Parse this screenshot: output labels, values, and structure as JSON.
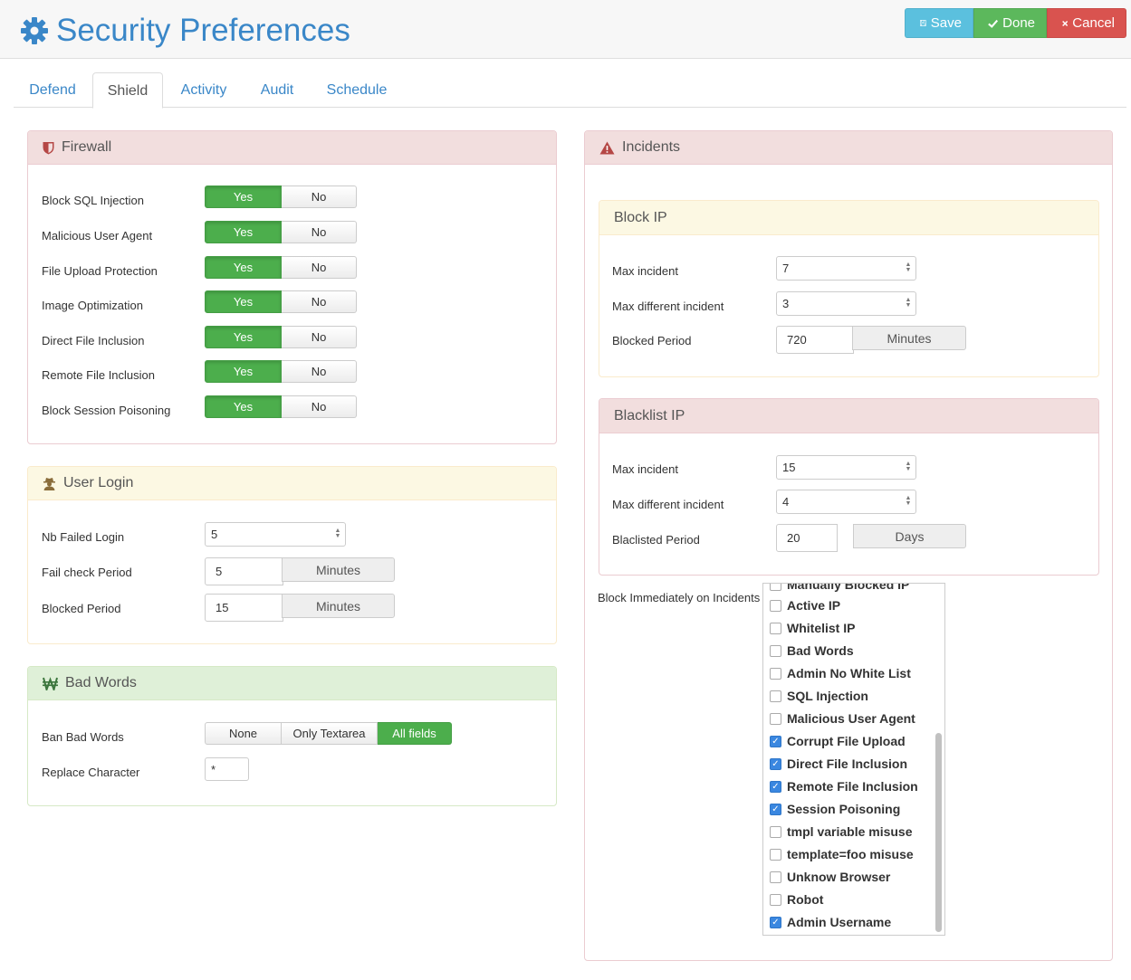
{
  "header": {
    "title": "Security Preferences",
    "buttons": {
      "save": "Save",
      "done": "Done",
      "cancel": "Cancel"
    }
  },
  "tabs": [
    {
      "label": "Defend"
    },
    {
      "label": "Shield",
      "active": true
    },
    {
      "label": "Activity"
    },
    {
      "label": "Audit"
    },
    {
      "label": "Schedule"
    }
  ],
  "firewall": {
    "title": "Firewall",
    "yes": "Yes",
    "no": "No",
    "rows": [
      {
        "label": "Block SQL Injection",
        "value": "Yes"
      },
      {
        "label": "Malicious User Agent",
        "value": "Yes"
      },
      {
        "label": "File Upload Protection",
        "value": "Yes"
      },
      {
        "label": "Image Optimization",
        "value": "Yes"
      },
      {
        "label": "Direct File Inclusion",
        "value": "Yes"
      },
      {
        "label": "Remote File Inclusion",
        "value": "Yes"
      },
      {
        "label": "Block Session Poisoning",
        "value": "Yes"
      }
    ]
  },
  "user_login": {
    "title": "User Login",
    "nb_failed_label": "Nb Failed Login",
    "nb_failed_value": "5",
    "fail_check_label": "Fail check Period",
    "fail_check_value": "5",
    "fail_check_unit": "Minutes",
    "blocked_label": "Blocked Period",
    "blocked_value": "15",
    "blocked_unit": "Minutes"
  },
  "bad_words": {
    "title": "Bad Words",
    "ban_label": "Ban Bad Words",
    "options": [
      "None",
      "Only Textarea",
      "All fields"
    ],
    "selected": "All fields",
    "replace_label": "Replace Character",
    "replace_value": "*"
  },
  "incidents": {
    "title": "Incidents",
    "block_ip": {
      "title": "Block IP",
      "max_incident_label": "Max incident",
      "max_incident_value": "7",
      "max_diff_label": "Max different incident",
      "max_diff_value": "3",
      "period_label": "Blocked Period",
      "period_value": "720",
      "period_unit": "Minutes"
    },
    "blacklist_ip": {
      "title": "Blacklist IP",
      "max_incident_label": "Max incident",
      "max_incident_value": "15",
      "max_diff_label": "Max different incident",
      "max_diff_value": "4",
      "period_label": "Blaclisted Period",
      "period_value": "20",
      "period_unit": "Days"
    },
    "block_immediately_label": "Block Immediately on Incidents",
    "list_items": [
      {
        "label": "Manually Blocked IP",
        "checked": false
      },
      {
        "label": "Active IP",
        "checked": false
      },
      {
        "label": "Whitelist IP",
        "checked": false
      },
      {
        "label": "Bad Words",
        "checked": false
      },
      {
        "label": "Admin No White List",
        "checked": false
      },
      {
        "label": "SQL Injection",
        "checked": false
      },
      {
        "label": "Malicious User Agent",
        "checked": false
      },
      {
        "label": "Corrupt File Upload",
        "checked": true
      },
      {
        "label": "Direct File Inclusion",
        "checked": true
      },
      {
        "label": "Remote File Inclusion",
        "checked": true
      },
      {
        "label": "Session Poisoning",
        "checked": true
      },
      {
        "label": "tmpl variable misuse",
        "checked": false
      },
      {
        "label": "template=foo misuse",
        "checked": false
      },
      {
        "label": "Unknow Browser",
        "checked": false
      },
      {
        "label": "Robot",
        "checked": false
      },
      {
        "label": "Admin Username",
        "checked": true
      }
    ]
  },
  "colors": {
    "accent": "#3a87c8",
    "yes_green": "#4cae4c",
    "save": "#5bc0de",
    "done": "#5cb85c",
    "cancel": "#d9534f"
  }
}
